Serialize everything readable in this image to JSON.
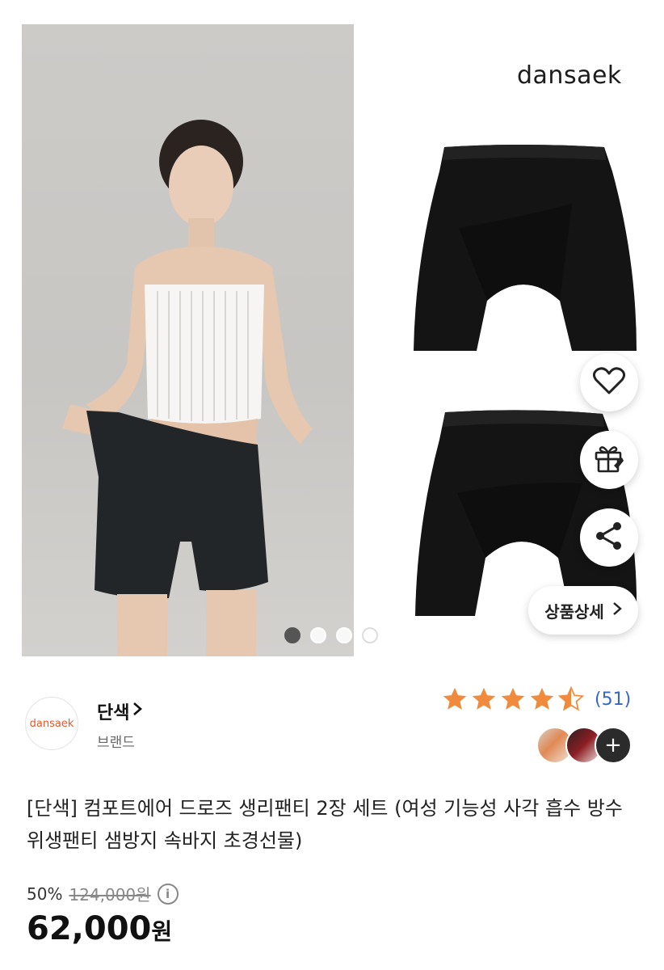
{
  "gallery": {
    "brand_wordmark": "dansaek",
    "total_slides": 4,
    "current_slide": 1,
    "detail_button": "상품상세",
    "actions": [
      "heart-icon",
      "gift-icon",
      "share-icon"
    ]
  },
  "brand": {
    "logo_text": "dansaek",
    "name": "단색",
    "type": "브랜드"
  },
  "rating": {
    "stars": 4.5,
    "count": "(51)",
    "star_color": "#f08a3c"
  },
  "product": {
    "title": "[단색] 컴포트에어 드로즈 생리팬티 2장 세트 (여성 기능성 사각 흡수 방수 위생팬티 샘방지 속바지 초경선물)",
    "discount": "50%",
    "original_price": "124,000원",
    "price_number": "62,000",
    "price_unit": "원"
  },
  "colors": {
    "link_blue": "#3766c9",
    "brand_orange": "#e5582a"
  }
}
